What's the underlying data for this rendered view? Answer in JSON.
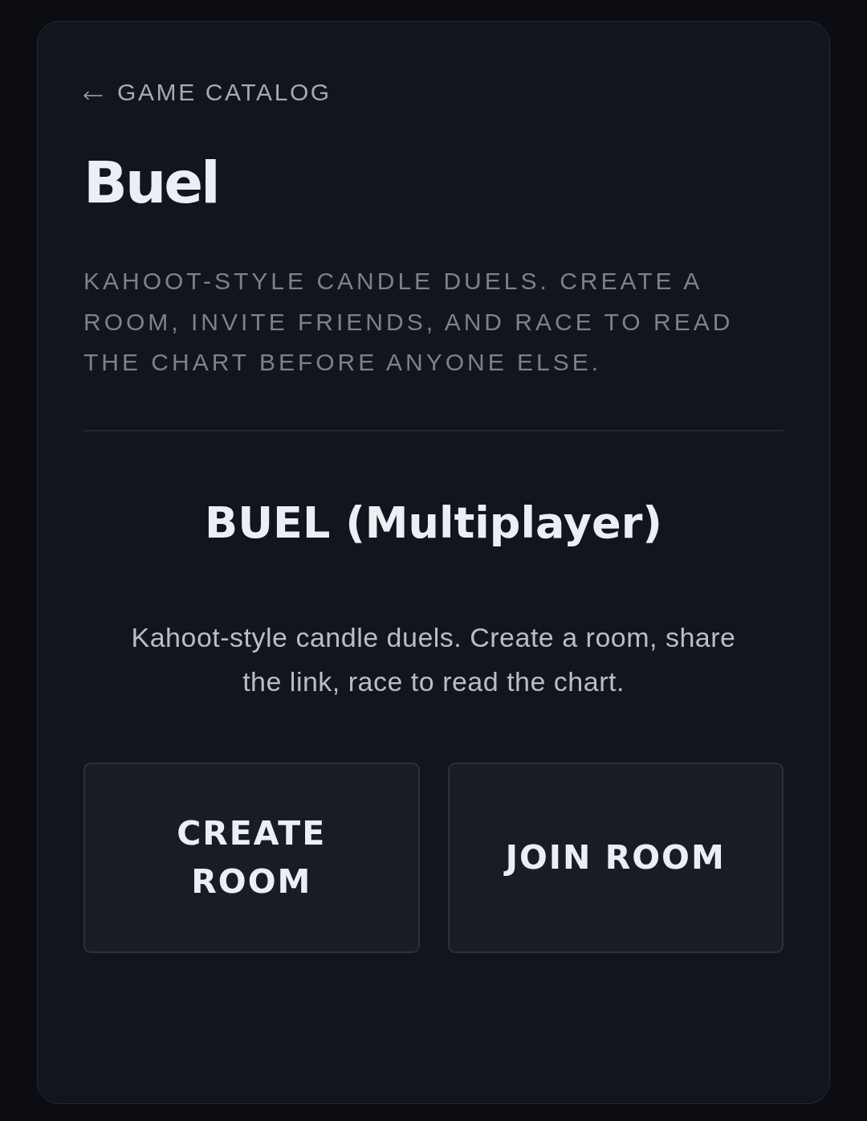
{
  "back_link": {
    "label": "GAME CATALOG"
  },
  "title": "Buel",
  "tagline": "KAHOOT-STYLE CANDLE DUELS. CREATE A ROOM, INVITE FRIENDS, AND RACE TO READ THE CHART BEFORE ANYONE ELSE.",
  "mode": {
    "heading": "BUEL (Multiplayer)",
    "description": "Kahoot-style candle duels. Create a room, share the link, race to read the chart."
  },
  "actions": [
    {
      "label": "CREATE ROOM"
    },
    {
      "label": "JOIN ROOM"
    }
  ]
}
